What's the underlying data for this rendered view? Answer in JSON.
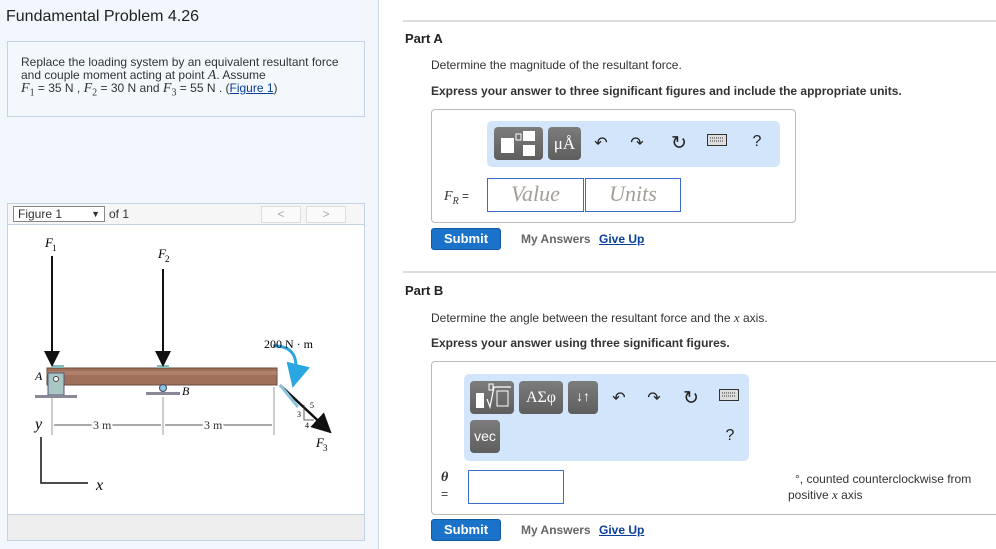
{
  "problem": {
    "title": "Fundamental Problem 4.26",
    "text_1": "Replace the loading system by an equivalent resultant force and couple moment acting at point ",
    "point": "A",
    "text_2": ". Assume",
    "f1_sym": "F",
    "f1_sub": "1",
    "f1_val": " = 35 N",
    "f2_sym": "F",
    "f2_sub": "2",
    "f2_val": " = 30 N",
    "and": " and ",
    "f3_sym": "F",
    "f3_sub": "3",
    "f3_val": " = 55 N",
    "figure_link": "Figure 1"
  },
  "figure": {
    "select": "Figure 1",
    "of": "of 1",
    "prev": "<",
    "next": ">",
    "labels": {
      "F1": "F",
      "F1s": "1",
      "F2": "F",
      "F2s": "2",
      "F3": "F",
      "F3s": "3",
      "moment": "200 N · m",
      "A": "A",
      "B": "B",
      "d1": "3 m",
      "d2": "3 m",
      "y": "y",
      "x": "x",
      "s3": "3",
      "s4": "4",
      "s5": "5"
    },
    "colors": {
      "beam": "#a0705a",
      "moment_arrow": "#2aa7e0"
    }
  },
  "partA": {
    "title": "Part A",
    "question": "Determine the magnitude of the resultant force.",
    "instruction": "Express your answer to three significant figures and include the appropriate units.",
    "toolbar": {
      "units_btn": "μÅ",
      "help": "?"
    },
    "label": "F",
    "label_sub": "R",
    "eq": " =",
    "value_placeholder": "Value",
    "units_placeholder": "Units",
    "submit": "Submit",
    "my_answers": "My Answers",
    "give_up": "Give Up"
  },
  "partB": {
    "title": "Part B",
    "question_1": "Determine the angle between the resultant force and the ",
    "question_var": "x",
    "question_2": " axis.",
    "instruction": "Express your answer using three significant figures.",
    "toolbar": {
      "greek_btn": "ΑΣφ",
      "arrows_btn": "↓↑",
      "vec_btn": "vec",
      "help": "?"
    },
    "label": "θ",
    "eq": "=",
    "value": "",
    "suffix_1": "°, counted counterclockwise from",
    "suffix_2": "positive ",
    "suffix_var": "x",
    "suffix_3": " axis",
    "submit": "Submit",
    "my_answers": "My Answers",
    "give_up": "Give Up"
  }
}
